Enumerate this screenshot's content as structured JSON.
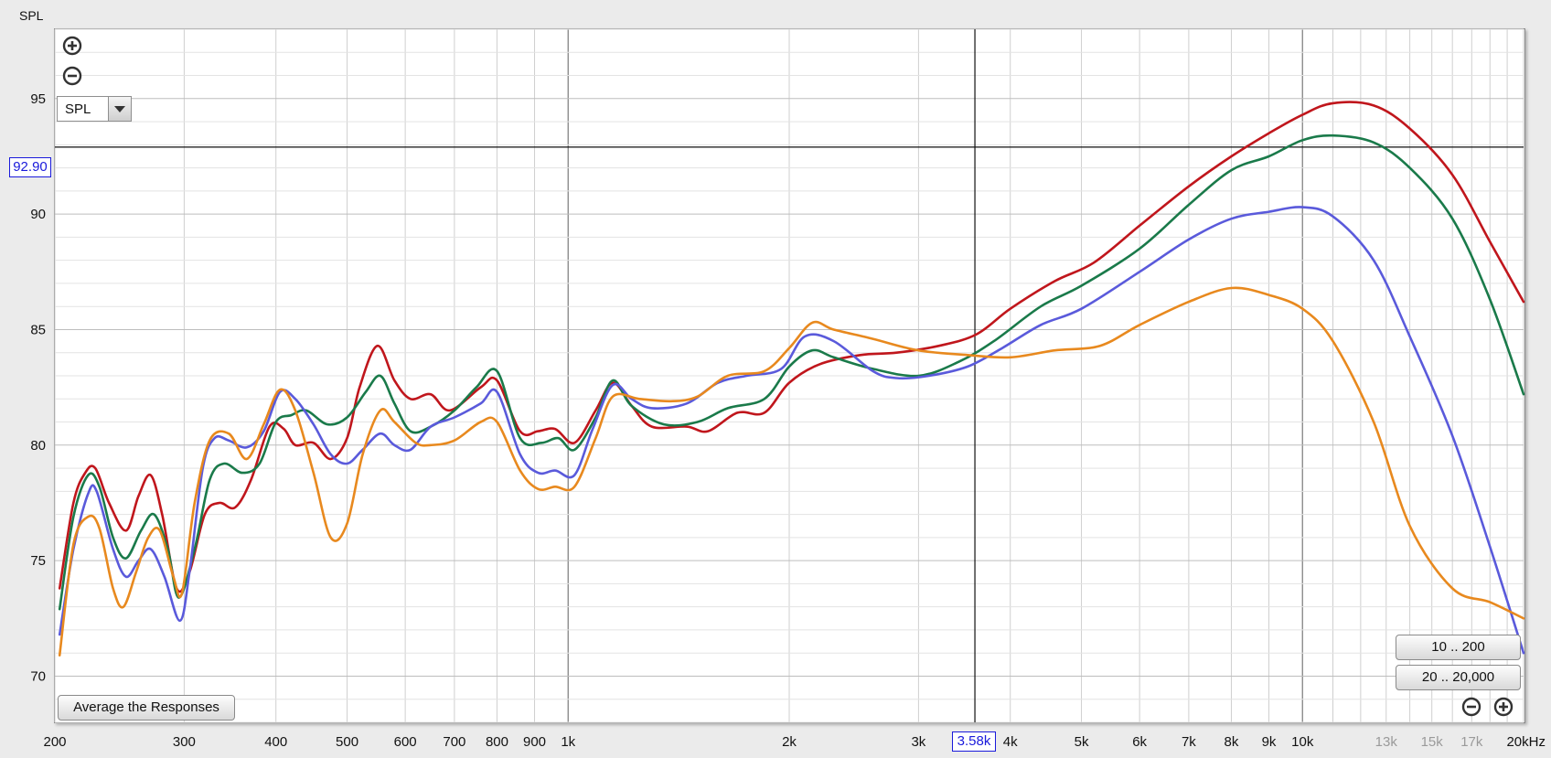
{
  "window": {
    "title": "SPL"
  },
  "controls": {
    "zoom_in_icon": "zoom-in-icon",
    "zoom_out_icon": "zoom-out-icon",
    "graph_selector": {
      "value": "SPL"
    },
    "average_button": "Average the Responses",
    "range_buttons": [
      "10 .. 200",
      "20 .. 20,000"
    ],
    "bottom_zoom_out_icon": "zoom-out-icon",
    "bottom_zoom_in_icon": "zoom-in-icon"
  },
  "cursor": {
    "y_readout": "92.90",
    "x_readout": "3.58k"
  },
  "chart_data": {
    "type": "line",
    "x_scale": "log",
    "xlim": [
      200,
      20000
    ],
    "ylim": [
      68,
      98
    ],
    "grid": true,
    "cursor_x": 3580,
    "cursor_y": 92.9,
    "x_tick_labels": [
      {
        "x": 200,
        "label": "200"
      },
      {
        "x": 300,
        "label": "300"
      },
      {
        "x": 400,
        "label": "400"
      },
      {
        "x": 500,
        "label": "500"
      },
      {
        "x": 600,
        "label": "600"
      },
      {
        "x": 700,
        "label": "700"
      },
      {
        "x": 800,
        "label": "800"
      },
      {
        "x": 900,
        "label": "900"
      },
      {
        "x": 1000,
        "label": "1k"
      },
      {
        "x": 2000,
        "label": "2k"
      },
      {
        "x": 3000,
        "label": "3k"
      },
      {
        "x": 4000,
        "label": "4k"
      },
      {
        "x": 5000,
        "label": "5k"
      },
      {
        "x": 6000,
        "label": "6k"
      },
      {
        "x": 7000,
        "label": "7k"
      },
      {
        "x": 8000,
        "label": "8k"
      },
      {
        "x": 9000,
        "label": "9k"
      },
      {
        "x": 10000,
        "label": "10k"
      },
      {
        "x": 13000,
        "label": "13k",
        "minor": true
      },
      {
        "x": 15000,
        "label": "15k",
        "minor": true
      },
      {
        "x": 17000,
        "label": "17k",
        "minor": true
      },
      {
        "x": 20000,
        "label": "20kHz"
      }
    ],
    "y_tick_labels": [
      {
        "y": 95,
        "label": "95"
      },
      {
        "y": 90,
        "label": "90"
      },
      {
        "y": 85,
        "label": "85"
      },
      {
        "y": 80,
        "label": "80"
      },
      {
        "y": 75,
        "label": "75"
      },
      {
        "y": 70,
        "label": "70"
      }
    ],
    "series": [
      {
        "color": "#c0161c",
        "points": [
          [
            203,
            73.8
          ],
          [
            212,
            77.5
          ],
          [
            220,
            78.8
          ],
          [
            227,
            79.0
          ],
          [
            237,
            77.5
          ],
          [
            250,
            76.3
          ],
          [
            260,
            77.8
          ],
          [
            270,
            78.7
          ],
          [
            280,
            77.0
          ],
          [
            293,
            73.8
          ],
          [
            305,
            74.5
          ],
          [
            320,
            77.0
          ],
          [
            335,
            77.5
          ],
          [
            352,
            77.3
          ],
          [
            370,
            78.5
          ],
          [
            392,
            80.8
          ],
          [
            410,
            80.7
          ],
          [
            425,
            80.0
          ],
          [
            450,
            80.1
          ],
          [
            475,
            79.4
          ],
          [
            500,
            80.3
          ],
          [
            520,
            82.5
          ],
          [
            550,
            84.3
          ],
          [
            580,
            82.8
          ],
          [
            610,
            82.0
          ],
          [
            650,
            82.2
          ],
          [
            690,
            81.5
          ],
          [
            760,
            82.5
          ],
          [
            800,
            82.8
          ],
          [
            860,
            80.6
          ],
          [
            910,
            80.6
          ],
          [
            960,
            80.7
          ],
          [
            1020,
            80.1
          ],
          [
            1090,
            81.5
          ],
          [
            1150,
            82.7
          ],
          [
            1220,
            81.7
          ],
          [
            1300,
            80.8
          ],
          [
            1450,
            80.8
          ],
          [
            1550,
            80.6
          ],
          [
            1700,
            81.4
          ],
          [
            1850,
            81.4
          ],
          [
            2000,
            82.7
          ],
          [
            2200,
            83.5
          ],
          [
            2500,
            83.9
          ],
          [
            2800,
            84.0
          ],
          [
            3200,
            84.3
          ],
          [
            3600,
            84.8
          ],
          [
            4000,
            85.9
          ],
          [
            4600,
            87.1
          ],
          [
            5200,
            87.9
          ],
          [
            6000,
            89.5
          ],
          [
            7000,
            91.2
          ],
          [
            8000,
            92.5
          ],
          [
            9000,
            93.5
          ],
          [
            10000,
            94.3
          ],
          [
            11000,
            94.8
          ],
          [
            12500,
            94.7
          ],
          [
            14000,
            93.7
          ],
          [
            16000,
            91.7
          ],
          [
            18000,
            88.8
          ],
          [
            20000,
            86.2
          ]
        ]
      },
      {
        "color": "#1a7a4a",
        "points": [
          [
            203,
            72.9
          ],
          [
            212,
            76.9
          ],
          [
            222,
            78.7
          ],
          [
            230,
            78.2
          ],
          [
            240,
            76.0
          ],
          [
            250,
            75.1
          ],
          [
            262,
            76.3
          ],
          [
            273,
            77.0
          ],
          [
            285,
            75.5
          ],
          [
            295,
            73.4
          ],
          [
            310,
            75.5
          ],
          [
            325,
            78.5
          ],
          [
            340,
            79.2
          ],
          [
            360,
            78.8
          ],
          [
            380,
            79.2
          ],
          [
            400,
            81.0
          ],
          [
            420,
            81.3
          ],
          [
            440,
            81.5
          ],
          [
            470,
            80.9
          ],
          [
            500,
            81.2
          ],
          [
            530,
            82.3
          ],
          [
            555,
            83.0
          ],
          [
            580,
            81.8
          ],
          [
            610,
            80.6
          ],
          [
            650,
            80.8
          ],
          [
            700,
            81.5
          ],
          [
            750,
            82.5
          ],
          [
            800,
            83.2
          ],
          [
            860,
            80.3
          ],
          [
            920,
            80.1
          ],
          [
            970,
            80.3
          ],
          [
            1020,
            79.8
          ],
          [
            1090,
            81.2
          ],
          [
            1150,
            82.8
          ],
          [
            1220,
            81.7
          ],
          [
            1350,
            80.9
          ],
          [
            1500,
            81.0
          ],
          [
            1650,
            81.6
          ],
          [
            1850,
            82.0
          ],
          [
            2000,
            83.4
          ],
          [
            2150,
            84.1
          ],
          [
            2300,
            83.8
          ],
          [
            2600,
            83.3
          ],
          [
            3000,
            83.0
          ],
          [
            3400,
            83.6
          ],
          [
            3800,
            84.5
          ],
          [
            4400,
            86.0
          ],
          [
            5000,
            86.9
          ],
          [
            6000,
            88.5
          ],
          [
            7000,
            90.4
          ],
          [
            8000,
            91.9
          ],
          [
            9000,
            92.5
          ],
          [
            10000,
            93.2
          ],
          [
            11000,
            93.4
          ],
          [
            12500,
            93.1
          ],
          [
            14000,
            92.0
          ],
          [
            16000,
            89.8
          ],
          [
            18000,
            86.3
          ],
          [
            20000,
            82.2
          ]
        ]
      },
      {
        "color": "#5a5adb",
        "points": [
          [
            203,
            71.8
          ],
          [
            212,
            75.5
          ],
          [
            222,
            77.9
          ],
          [
            228,
            78.0
          ],
          [
            240,
            75.5
          ],
          [
            250,
            74.3
          ],
          [
            260,
            75.0
          ],
          [
            270,
            75.5
          ],
          [
            282,
            74.3
          ],
          [
            296,
            72.4
          ],
          [
            305,
            74.5
          ],
          [
            318,
            79.0
          ],
          [
            330,
            80.3
          ],
          [
            345,
            80.2
          ],
          [
            365,
            79.9
          ],
          [
            385,
            80.6
          ],
          [
            405,
            82.3
          ],
          [
            425,
            82.0
          ],
          [
            450,
            80.9
          ],
          [
            475,
            79.6
          ],
          [
            500,
            79.2
          ],
          [
            525,
            79.8
          ],
          [
            555,
            80.5
          ],
          [
            580,
            80.0
          ],
          [
            610,
            79.8
          ],
          [
            650,
            80.8
          ],
          [
            700,
            81.2
          ],
          [
            760,
            81.8
          ],
          [
            800,
            82.3
          ],
          [
            860,
            79.6
          ],
          [
            910,
            78.8
          ],
          [
            960,
            78.9
          ],
          [
            1020,
            78.7
          ],
          [
            1080,
            80.7
          ],
          [
            1150,
            82.6
          ],
          [
            1220,
            82.0
          ],
          [
            1300,
            81.6
          ],
          [
            1450,
            81.8
          ],
          [
            1600,
            82.7
          ],
          [
            1750,
            83.0
          ],
          [
            1950,
            83.3
          ],
          [
            2100,
            84.7
          ],
          [
            2300,
            84.5
          ],
          [
            2600,
            83.2
          ],
          [
            2800,
            82.9
          ],
          [
            3100,
            83.0
          ],
          [
            3500,
            83.4
          ],
          [
            3900,
            84.2
          ],
          [
            4400,
            85.2
          ],
          [
            5000,
            85.9
          ],
          [
            6000,
            87.5
          ],
          [
            7000,
            88.9
          ],
          [
            8000,
            89.8
          ],
          [
            9000,
            90.1
          ],
          [
            10000,
            90.3
          ],
          [
            11000,
            89.9
          ],
          [
            12500,
            88.0
          ],
          [
            14000,
            84.7
          ],
          [
            16000,
            80.4
          ],
          [
            18000,
            75.6
          ],
          [
            20000,
            71.0
          ]
        ]
      },
      {
        "color": "#e8891e",
        "points": [
          [
            203,
            70.9
          ],
          [
            212,
            75.7
          ],
          [
            222,
            76.9
          ],
          [
            230,
            76.4
          ],
          [
            240,
            73.8
          ],
          [
            248,
            73.0
          ],
          [
            258,
            74.5
          ],
          [
            268,
            76.0
          ],
          [
            278,
            76.3
          ],
          [
            290,
            74.3
          ],
          [
            298,
            73.6
          ],
          [
            310,
            77.5
          ],
          [
            325,
            80.2
          ],
          [
            345,
            80.5
          ],
          [
            365,
            79.4
          ],
          [
            385,
            80.9
          ],
          [
            405,
            82.4
          ],
          [
            425,
            81.5
          ],
          [
            450,
            78.8
          ],
          [
            475,
            76.0
          ],
          [
            500,
            76.6
          ],
          [
            525,
            79.6
          ],
          [
            555,
            81.5
          ],
          [
            580,
            81.0
          ],
          [
            620,
            80.1
          ],
          [
            650,
            80.0
          ],
          [
            700,
            80.2
          ],
          [
            760,
            81.0
          ],
          [
            800,
            81.0
          ],
          [
            860,
            78.9
          ],
          [
            910,
            78.1
          ],
          [
            960,
            78.2
          ],
          [
            1020,
            78.2
          ],
          [
            1090,
            80.3
          ],
          [
            1150,
            82.1
          ],
          [
            1250,
            82.0
          ],
          [
            1380,
            81.9
          ],
          [
            1500,
            82.1
          ],
          [
            1650,
            83.0
          ],
          [
            1850,
            83.2
          ],
          [
            2000,
            84.2
          ],
          [
            2150,
            85.3
          ],
          [
            2300,
            85.0
          ],
          [
            2600,
            84.6
          ],
          [
            3000,
            84.1
          ],
          [
            3500,
            83.9
          ],
          [
            4000,
            83.8
          ],
          [
            4600,
            84.1
          ],
          [
            5300,
            84.3
          ],
          [
            6000,
            85.2
          ],
          [
            7000,
            86.2
          ],
          [
            8000,
            86.8
          ],
          [
            9000,
            86.5
          ],
          [
            10000,
            85.9
          ],
          [
            11000,
            84.5
          ],
          [
            12500,
            81.0
          ],
          [
            14000,
            76.5
          ],
          [
            16000,
            73.8
          ],
          [
            18000,
            73.2
          ],
          [
            20000,
            72.5
          ]
        ]
      }
    ]
  }
}
